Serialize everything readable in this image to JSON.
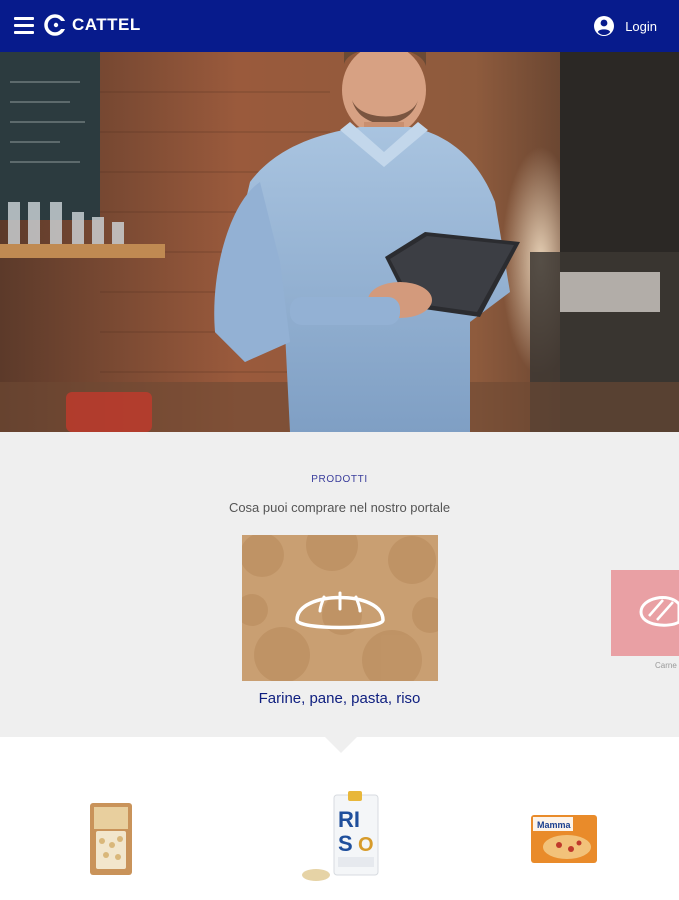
{
  "header": {
    "brand": "CATTEL",
    "login_label": "Login",
    "menu_icon": "hamburger-menu-icon",
    "login_icon": "account-circle-icon",
    "colors": {
      "bar": "#071b8c",
      "text": "#ffffff"
    }
  },
  "hero": {
    "image": "man-with-tablet-in-cafe"
  },
  "products": {
    "kicker": "PRODOTTI",
    "subtitle": "Cosa puoi comprare nel nostro portale",
    "active_category": {
      "title": "Farine, pane, pasta, riso",
      "icon": "bread-icon"
    },
    "next_category": {
      "label": "Carne",
      "icon": "steak-icon"
    },
    "colors": {
      "title": "#0e1e7f",
      "kicker": "#3a3d9c",
      "card_bg": "#c79d6e",
      "next_card_bg": "#e89a9f"
    }
  },
  "items": [
    {
      "name": "oat-flakes-bag"
    },
    {
      "name": "rice-bag",
      "label": "RISO"
    },
    {
      "name": "pizza-pack",
      "label": "Mamma"
    }
  ]
}
